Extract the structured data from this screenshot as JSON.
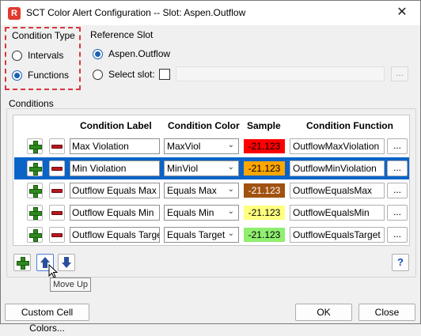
{
  "window": {
    "title": "SCT Color Alert Configuration -- Slot: Aspen.Outflow",
    "app_icon_letter": "R",
    "close_symbol": "✕"
  },
  "condition_type": {
    "label": "Condition Type",
    "options": [
      {
        "label": "Intervals",
        "selected": false
      },
      {
        "label": "Functions",
        "selected": true
      }
    ]
  },
  "reference_slot": {
    "label": "Reference Slot",
    "option_slot": "Aspen.Outflow",
    "option_select": "Select slot:",
    "select_button": "..."
  },
  "conditions": {
    "label": "Conditions",
    "columns": [
      "Condition Label",
      "Condition Color",
      "Sample",
      "Condition Function"
    ],
    "rows": [
      {
        "label": "Max Violation",
        "color": "MaxViol",
        "sample": "-21.123",
        "sample_bg": "#ff0000",
        "sample_fg": "#000000",
        "function": "OutflowMaxViolation",
        "selected": false
      },
      {
        "label": "Min Violation",
        "color": "MinViol",
        "sample": "-21.123",
        "sample_bg": "#ffa500",
        "sample_fg": "#000000",
        "function": "OutflowMinViolation",
        "selected": true
      },
      {
        "label": "Outflow Equals Max",
        "color": "Equals Max",
        "sample": "-21.123",
        "sample_bg": "#a0520f",
        "sample_fg": "#ffffff",
        "function": "OutflowEqualsMax",
        "selected": false
      },
      {
        "label": "Outflow Equals Min",
        "color": "Equals Min",
        "sample": "-21.123",
        "sample_bg": "#ffff80",
        "sample_fg": "#000000",
        "function": "OutflowEqualsMin",
        "selected": false
      },
      {
        "label": "Outflow Equals Target",
        "color": "Equals Target",
        "sample": "-21.123",
        "sample_bg": "#90ee70",
        "sample_fg": "#000000",
        "function": "OutflowEqualsTarget",
        "selected": false
      }
    ],
    "row_function_button": "..."
  },
  "tooltip": "Move Up",
  "help_label": "?",
  "buttons": {
    "custom_colors": "Custom Cell Colors...",
    "ok": "OK",
    "close": "Close"
  }
}
